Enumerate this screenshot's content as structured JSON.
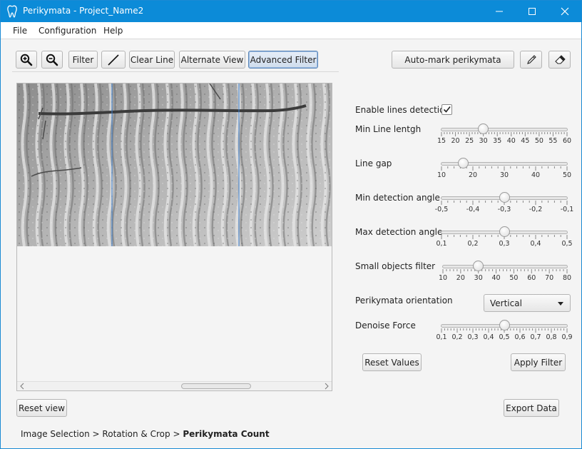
{
  "window": {
    "title": "Perikymata - Project_Name2"
  },
  "menu": [
    "File",
    "Configuration",
    "Help"
  ],
  "toolbar": {
    "zoom_in_icon": "zoom-in-icon",
    "zoom_out_icon": "zoom-out-icon",
    "filter_label": "Filter",
    "line_icon": "line-draw-icon",
    "clear_line_label": "Clear Line",
    "alternate_view_label": "Alternate View",
    "advanced_filter_label": "Advanced Filter",
    "auto_mark_label": "Auto-mark perikymata",
    "pencil_icon": "pencil-icon",
    "eraser_icon": "eraser-icon"
  },
  "settings": {
    "enable_lines_label": "Enable lines detection",
    "enable_lines_checked": true,
    "sliders": [
      {
        "label": "Min Line lentgh",
        "ticks": [
          "15",
          "20",
          "25",
          "30",
          "35",
          "40",
          "45",
          "50",
          "55",
          "60"
        ],
        "min": 15,
        "max": 60,
        "value": 30
      },
      {
        "label": "Line gap",
        "ticks": [
          "10",
          "20",
          "30",
          "40",
          "50"
        ],
        "min": 10,
        "max": 50,
        "value": 17
      },
      {
        "label": "Min detection angle",
        "ticks": [
          "-0,5",
          "-0,4",
          "-0,3",
          "-0,2",
          "-0,1"
        ],
        "min": -0.5,
        "max": -0.1,
        "value": -0.3
      },
      {
        "label": "Max detection angle",
        "ticks": [
          "0,1",
          "0,2",
          "0,3",
          "0,4",
          "0,5"
        ],
        "min": 0.1,
        "max": 0.5,
        "value": 0.3
      },
      {
        "label": "Small objects filter",
        "ticks": [
          "10",
          "20",
          "30",
          "40",
          "50",
          "60",
          "70",
          "80"
        ],
        "min": 10,
        "max": 80,
        "value": 30
      }
    ],
    "orientation_label": "Perikymata orientation",
    "orientation_value": "Vertical",
    "denoise": {
      "label": "Denoise Force",
      "ticks": [
        "0,1",
        "0,2",
        "0,3",
        "0,4",
        "0,5",
        "0,6",
        "0,7",
        "0,8",
        "0,9"
      ],
      "min": 0.1,
      "max": 0.9,
      "value": 0.5
    },
    "reset_values_label": "Reset Values",
    "apply_filter_label": "Apply Filter"
  },
  "footer": {
    "reset_view_label": "Reset view",
    "export_data_label": "Export Data"
  },
  "breadcrumb": {
    "step1": "Image Selection",
    "sep": ">",
    "step2": "Rotation & Crop",
    "step3": "Perikymata Count"
  },
  "colors": {
    "titlebar": "#0c8bd8",
    "guide_line": "#3a7fd0"
  }
}
